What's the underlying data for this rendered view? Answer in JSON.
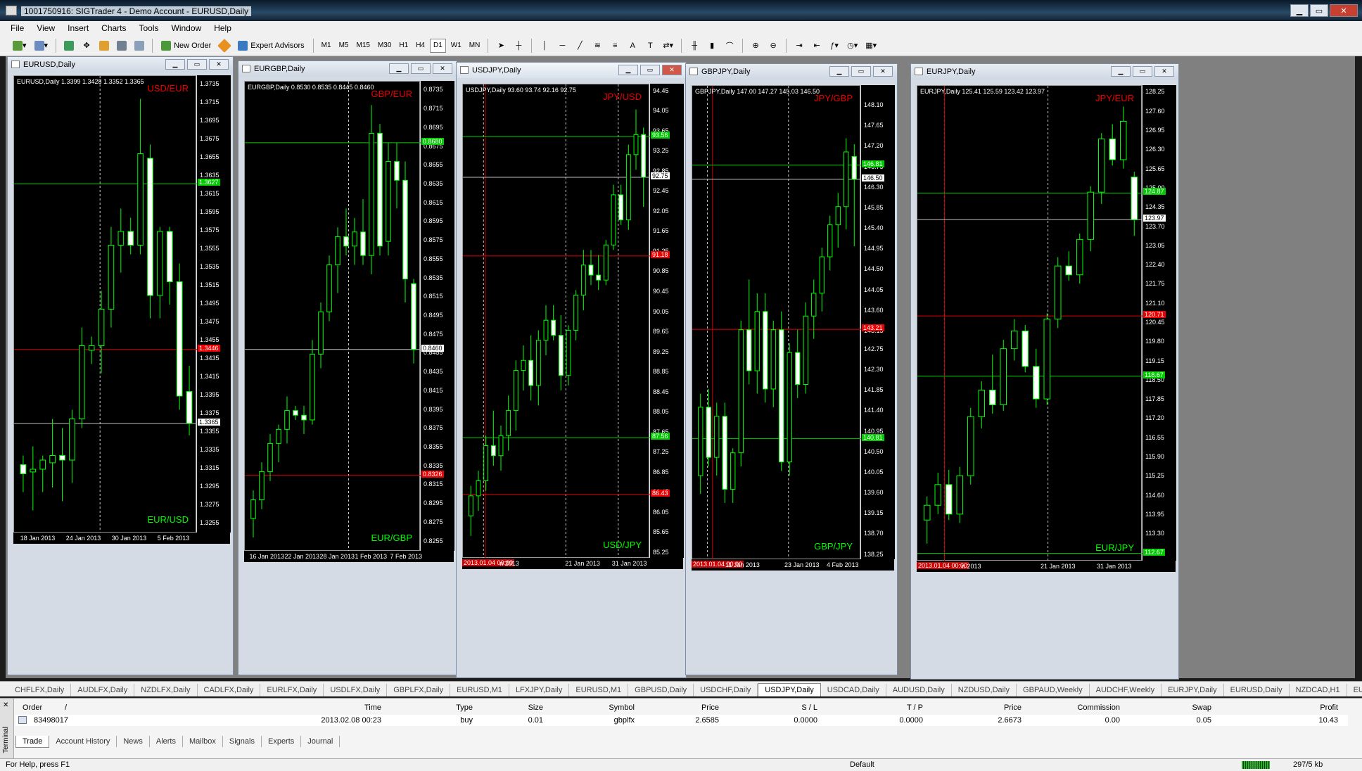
{
  "app": {
    "title": "1001750916: SIGTrader 4 - Demo Account - EURUSD,Daily"
  },
  "menu": [
    "File",
    "View",
    "Insert",
    "Charts",
    "Tools",
    "Window",
    "Help"
  ],
  "toolbar": {
    "new_order": "New Order",
    "expert_advisors": "Expert Advisors",
    "timeframes": [
      "M1",
      "M5",
      "M15",
      "M30",
      "H1",
      "H4",
      "D1",
      "W1",
      "MN"
    ],
    "active_tf": "D1"
  },
  "charts": [
    {
      "title": "EURUSD,Daily",
      "info": "EURUSD,Daily  1.3399 1.3428 1.3352 1.3365",
      "top_label": "USD/EUR",
      "bottom_label": "EUR/USD",
      "ticks": [
        "1.3735",
        "1.3715",
        "1.3695",
        "1.3675",
        "1.3655",
        "1.3635",
        "1.3615",
        "1.3595",
        "1.3575",
        "1.3555",
        "1.3535",
        "1.3515",
        "1.3495",
        "1.3475",
        "1.3455",
        "1.3435",
        "1.3415",
        "1.3395",
        "1.3375",
        "1.3355",
        "1.3335",
        "1.3315",
        "1.3295",
        "1.3275",
        "1.3255"
      ],
      "ymin": 1.3245,
      "ymax": 1.3745,
      "lines": [
        {
          "price": 1.3627,
          "color": "#00d000",
          "tag": "1.3627"
        },
        {
          "price": 1.3446,
          "color": "#e00000",
          "tag": "1.3446"
        },
        {
          "price": 1.3365,
          "color": "#c0c0c0",
          "tag": "1.3365"
        }
      ],
      "dates": [
        "18 Jan 2013",
        "24 Jan 2013",
        "30 Jan 2013",
        "5 Feb 2013"
      ],
      "vlines": [
        0.47
      ],
      "candles": [
        [
          1.332,
          1.333,
          1.329,
          1.331
        ],
        [
          1.3312,
          1.334,
          1.327,
          1.3315
        ],
        [
          1.3315,
          1.333,
          1.329,
          1.3325
        ],
        [
          1.3322,
          1.337,
          1.3295,
          1.333
        ],
        [
          1.333,
          1.336,
          1.328,
          1.3325
        ],
        [
          1.3325,
          1.338,
          1.33,
          1.337
        ],
        [
          1.337,
          1.347,
          1.336,
          1.345
        ],
        [
          1.3445,
          1.346,
          1.343,
          1.345
        ],
        [
          1.345,
          1.351,
          1.342,
          1.349
        ],
        [
          1.349,
          1.358,
          1.347,
          1.356
        ],
        [
          1.356,
          1.36,
          1.353,
          1.3575
        ],
        [
          1.3575,
          1.359,
          1.355,
          1.356
        ],
        [
          1.356,
          1.372,
          1.355,
          1.366
        ],
        [
          1.3655,
          1.367,
          1.348,
          1.3505
        ],
        [
          1.3505,
          1.358,
          1.348,
          1.3575
        ],
        [
          1.3575,
          1.358,
          1.3495,
          1.352
        ],
        [
          1.352,
          1.354,
          1.338,
          1.3395
        ],
        [
          1.34,
          1.3428,
          1.3352,
          1.3365
        ]
      ]
    },
    {
      "title": "EURGBP,Daily",
      "info": "EURGBP,Daily  0.8530 0.8535 0.8445 0.8460",
      "top_label": "GBP/EUR",
      "bottom_label": "EUR/GBP",
      "ticks": [
        "0.8735",
        "0.8715",
        "0.8695",
        "0.8675",
        "0.8655",
        "0.8635",
        "0.8615",
        "0.8595",
        "0.8575",
        "0.8555",
        "0.8535",
        "0.8515",
        "0.8495",
        "0.8475",
        "0.8455",
        "0.8435",
        "0.8415",
        "0.8395",
        "0.8375",
        "0.8355",
        "0.8335",
        "0.8315",
        "0.8295",
        "0.8275",
        "0.8255"
      ],
      "ymin": 0.8245,
      "ymax": 0.8745,
      "lines": [
        {
          "price": 0.868,
          "color": "#00d000",
          "tag": "0.8680"
        },
        {
          "price": 0.846,
          "color": "#c0c0c0",
          "tag": "0.8460"
        },
        {
          "price": 0.8326,
          "color": "#e00000",
          "tag": "0.8326"
        }
      ],
      "dates": [
        "16 Jan 2013",
        "22 Jan 2013",
        "28 Jan 2013",
        "1 Feb 2013",
        "7 Feb 2013"
      ],
      "vlines": [
        0.59
      ],
      "candles": [
        [
          0.828,
          0.831,
          0.826,
          0.83
        ],
        [
          0.83,
          0.834,
          0.829,
          0.833
        ],
        [
          0.833,
          0.837,
          0.832,
          0.836
        ],
        [
          0.836,
          0.838,
          0.834,
          0.8375
        ],
        [
          0.8375,
          0.841,
          0.836,
          0.8395
        ],
        [
          0.8395,
          0.84,
          0.8385,
          0.839
        ],
        [
          0.839,
          0.84,
          0.837,
          0.8385
        ],
        [
          0.8385,
          0.847,
          0.838,
          0.8455
        ],
        [
          0.8455,
          0.851,
          0.844,
          0.85
        ],
        [
          0.85,
          0.856,
          0.849,
          0.855
        ],
        [
          0.855,
          0.859,
          0.852,
          0.858
        ],
        [
          0.858,
          0.861,
          0.856,
          0.857
        ],
        [
          0.857,
          0.86,
          0.855,
          0.8585
        ],
        [
          0.8585,
          0.862,
          0.855,
          0.856
        ],
        [
          0.856,
          0.872,
          0.854,
          0.869
        ],
        [
          0.869,
          0.87,
          0.856,
          0.857
        ],
        [
          0.8575,
          0.868,
          0.856,
          0.866
        ],
        [
          0.866,
          0.868,
          0.861,
          0.864
        ],
        [
          0.864,
          0.866,
          0.851,
          0.8535
        ],
        [
          0.853,
          0.8535,
          0.8445,
          0.846
        ]
      ]
    },
    {
      "title": "USDJPY,Daily",
      "info": "USDJPY,Daily  93.60 93.74 92.16 92.75",
      "top_label": "JPY/USD",
      "bottom_label": "USD/JPY",
      "ticks": [
        "94.45",
        "94.05",
        "93.65",
        "93.25",
        "92.85",
        "92.45",
        "92.05",
        "91.65",
        "91.25",
        "90.85",
        "90.45",
        "90.05",
        "89.65",
        "89.25",
        "88.85",
        "88.45",
        "88.05",
        "87.65",
        "87.25",
        "86.85",
        "86.45",
        "86.05",
        "85.65",
        "85.25"
      ],
      "ymin": 85.15,
      "ymax": 94.6,
      "lines": [
        {
          "price": 93.56,
          "color": "#00d000",
          "tag": "93.56"
        },
        {
          "price": 92.75,
          "color": "#c0c0c0",
          "tag": "92.75"
        },
        {
          "price": 91.18,
          "color": "#e00000",
          "tag": "91.18"
        },
        {
          "price": 87.56,
          "color": "#00d000",
          "tag": "87.56"
        },
        {
          "price": 86.43,
          "color": "#e00000",
          "tag": "86.43"
        }
      ],
      "dates": [
        "2013.01.04 00:00",
        "n 2013",
        "21 Jan 2013",
        "31 Jan 2013"
      ],
      "vlines": [
        0.11,
        0.55,
        0.83
      ],
      "candles": [
        [
          86.0,
          86.6,
          85.6,
          86.4
        ],
        [
          86.4,
          86.9,
          86.1,
          86.7
        ],
        [
          86.7,
          87.6,
          86.5,
          87.4
        ],
        [
          87.4,
          88.1,
          87.0,
          87.2
        ],
        [
          87.2,
          87.8,
          86.9,
          87.6
        ],
        [
          87.6,
          88.4,
          87.3,
          88.1
        ],
        [
          88.1,
          89.1,
          87.7,
          88.9
        ],
        [
          88.9,
          89.4,
          88.5,
          89.1
        ],
        [
          89.1,
          89.6,
          88.3,
          88.6
        ],
        [
          88.6,
          89.7,
          88.2,
          89.5
        ],
        [
          89.5,
          90.2,
          89.2,
          89.9
        ],
        [
          89.9,
          90.2,
          89.5,
          89.6
        ],
        [
          89.6,
          90.0,
          88.5,
          88.8
        ],
        [
          88.8,
          89.8,
          88.6,
          89.7
        ],
        [
          89.7,
          90.5,
          89.5,
          90.4
        ],
        [
          90.4,
          91.3,
          90.1,
          91.0
        ],
        [
          91.0,
          91.3,
          90.6,
          90.8
        ],
        [
          90.8,
          91.2,
          90.5,
          90.7
        ],
        [
          90.7,
          91.5,
          90.6,
          91.4
        ],
        [
          91.4,
          92.6,
          91.3,
          92.4
        ],
        [
          92.4,
          92.6,
          91.8,
          91.9
        ],
        [
          91.9,
          93.4,
          91.7,
          93.2
        ],
        [
          93.2,
          94.1,
          92.9,
          93.6
        ],
        [
          93.6,
          93.74,
          92.16,
          92.75
        ]
      ]
    },
    {
      "title": "GBPJPY,Daily",
      "info": "GBPJPY,Daily  147.00 147.27 145.03 146.50",
      "top_label": "JPY/GBP",
      "bottom_label": "GBP/JPY",
      "ticks": [
        "148.10",
        "147.65",
        "147.20",
        "146.75",
        "146.30",
        "145.85",
        "145.40",
        "144.95",
        "144.50",
        "144.05",
        "143.60",
        "143.15",
        "142.75",
        "142.30",
        "141.85",
        "141.40",
        "140.95",
        "140.50",
        "140.05",
        "139.60",
        "139.15",
        "138.70",
        "138.25"
      ],
      "ymin": 138.15,
      "ymax": 148.55,
      "lines": [
        {
          "price": 146.81,
          "color": "#00d000",
          "tag": "146.81"
        },
        {
          "price": 146.5,
          "color": "#c0c0c0",
          "tag": "146.50"
        },
        {
          "price": 143.21,
          "color": "#e00000",
          "tag": "143.21"
        },
        {
          "price": 140.81,
          "color": "#00d000",
          "tag": "140.81"
        }
      ],
      "dates": [
        "2013.01.04 00:00",
        "11 Jan 2013",
        "23 Jan 2013",
        "4 Feb 2013"
      ],
      "vlines": [
        0.09,
        0.57
      ],
      "candles": [
        [
          140.0,
          141.8,
          139.6,
          141.5
        ],
        [
          141.5,
          141.9,
          140.2,
          140.4
        ],
        [
          140.4,
          141.6,
          140.0,
          141.3
        ],
        [
          141.3,
          141.6,
          139.4,
          139.7
        ],
        [
          139.7,
          140.6,
          139.4,
          140.5
        ],
        [
          140.5,
          143.4,
          140.2,
          143.2
        ],
        [
          143.2,
          144.3,
          142.0,
          142.3
        ],
        [
          142.3,
          144.0,
          141.8,
          143.6
        ],
        [
          143.6,
          144.0,
          141.6,
          141.9
        ],
        [
          141.9,
          143.4,
          141.5,
          143.2
        ],
        [
          143.2,
          143.6,
          140.1,
          140.3
        ],
        [
          140.3,
          142.9,
          140.0,
          142.7
        ],
        [
          142.7,
          143.2,
          141.7,
          142.0
        ],
        [
          142.0,
          143.8,
          141.8,
          143.5
        ],
        [
          143.5,
          144.3,
          143.0,
          144.0
        ],
        [
          144.0,
          145.0,
          143.6,
          144.8
        ],
        [
          144.8,
          145.7,
          144.5,
          145.5
        ],
        [
          145.5,
          146.2,
          145.0,
          145.9
        ],
        [
          145.9,
          147.4,
          145.4,
          147.1
        ],
        [
          147.0,
          147.27,
          145.03,
          146.5
        ]
      ]
    },
    {
      "title": "EURJPY,Daily",
      "info": "EURJPY,Daily  125.41 125.59 123.42 123.97",
      "top_label": "JPY/EUR",
      "bottom_label": "EUR/JPY",
      "ticks": [
        "128.25",
        "127.60",
        "126.95",
        "126.30",
        "125.65",
        "125.00",
        "124.35",
        "123.70",
        "123.05",
        "122.40",
        "121.75",
        "121.10",
        "120.45",
        "119.80",
        "119.15",
        "118.50",
        "117.85",
        "117.20",
        "116.55",
        "115.90",
        "115.25",
        "114.60",
        "113.95",
        "113.30",
        "112.65"
      ],
      "ymin": 112.4,
      "ymax": 128.5,
      "lines": [
        {
          "price": 124.87,
          "color": "#00d000",
          "tag": "124.87"
        },
        {
          "price": 123.97,
          "color": "#c0c0c0",
          "tag": "123.97"
        },
        {
          "price": 120.71,
          "color": "#e00000",
          "tag": "120.71"
        },
        {
          "price": 118.67,
          "color": "#00d000",
          "tag": "118.67"
        },
        {
          "price": 112.67,
          "color": "#00d000",
          "tag": "112.67"
        }
      ],
      "dates": [
        "2013.01.04 00:00",
        "n 2013",
        "21 Jan 2013",
        "31 Jan 2013"
      ],
      "vlines": [
        0.12,
        0.58
      ],
      "candles": [
        [
          113.8,
          114.6,
          113.0,
          114.3
        ],
        [
          114.3,
          115.4,
          114.0,
          115.0
        ],
        [
          115.0,
          115.5,
          113.8,
          114.0
        ],
        [
          114.0,
          115.6,
          113.7,
          115.3
        ],
        [
          115.3,
          117.6,
          115.0,
          117.3
        ],
        [
          117.3,
          118.5,
          116.9,
          118.2
        ],
        [
          118.2,
          119.4,
          117.4,
          117.7
        ],
        [
          117.7,
          119.9,
          117.5,
          119.6
        ],
        [
          119.6,
          120.6,
          119.2,
          120.2
        ],
        [
          120.2,
          120.4,
          118.8,
          119.0
        ],
        [
          119.0,
          119.6,
          117.6,
          117.9
        ],
        [
          117.9,
          120.8,
          117.7,
          120.6
        ],
        [
          120.6,
          122.7,
          120.3,
          122.4
        ],
        [
          122.4,
          122.9,
          121.9,
          122.1
        ],
        [
          122.1,
          123.5,
          121.8,
          123.3
        ],
        [
          123.3,
          125.1,
          122.9,
          124.9
        ],
        [
          124.9,
          126.9,
          124.5,
          126.7
        ],
        [
          126.7,
          127.2,
          125.8,
          126.0
        ],
        [
          126.0,
          127.8,
          125.7,
          127.3
        ],
        [
          125.41,
          125.59,
          123.42,
          123.97
        ]
      ]
    }
  ],
  "window_tabs": [
    "CHFLFX,Daily",
    "AUDLFX,Daily",
    "NZDLFX,Daily",
    "CADLFX,Daily",
    "EURLFX,Daily",
    "USDLFX,Daily",
    "GBPLFX,Daily",
    "EURUSD,M1",
    "LFXJPY,Daily",
    "EURUSD,M1",
    "GBPUSD,Daily",
    "USDCHF,Daily",
    "USDJPY,Daily",
    "USDCAD,Daily",
    "AUDUSD,Daily",
    "NZDUSD,Daily",
    "GBPAUD,Weekly",
    "AUDCHF,Weekly",
    "EURJPY,Daily",
    "EURUSD,Daily",
    "NZDCAD,H1",
    "EUR"
  ],
  "active_tab": "USDJPY,Daily",
  "terminal": {
    "side_label": "Terminal",
    "headers": [
      "Order",
      "/",
      "Time",
      "Type",
      "Size",
      "Symbol",
      "Price",
      "S / L",
      "T / P",
      "Price",
      "Commission",
      "Swap",
      "Profit"
    ],
    "row": [
      "83498017",
      "2013.02.08 00:23",
      "buy",
      "0.01",
      "gbplfx",
      "2.6585",
      "0.0000",
      "0.0000",
      "2.6673",
      "0.00",
      "0.05",
      "10.43"
    ],
    "tabs": [
      "Trade",
      "Account History",
      "News",
      "Alerts",
      "Mailbox",
      "Signals",
      "Experts",
      "Journal"
    ],
    "active_tab": "Trade"
  },
  "status": {
    "help": "For Help, press F1",
    "profile": "Default",
    "traffic": "297/5 kb"
  },
  "colors": {
    "bull": "#00ff00",
    "bear": "#ffffff",
    "wick": "#00ff00"
  }
}
